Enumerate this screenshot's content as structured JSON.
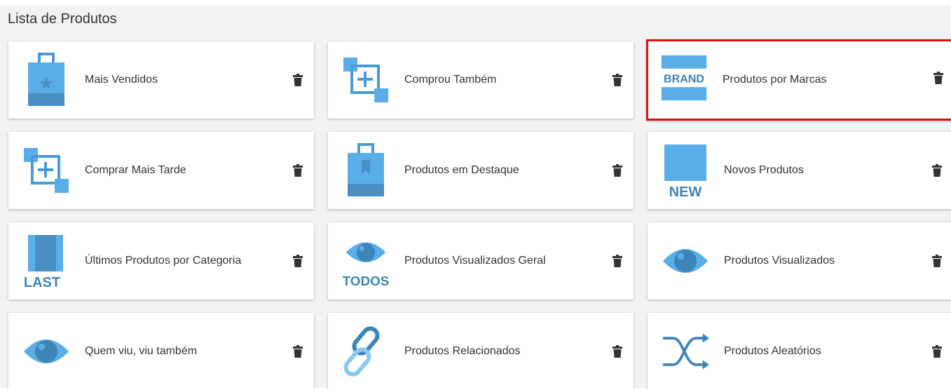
{
  "page": {
    "title": "Lista de Produtos"
  },
  "cards": [
    {
      "label": "Mais Vendidos",
      "icon": "shopping-bag-star-icon"
    },
    {
      "label": "Comprou Também",
      "icon": "add-squares-icon"
    },
    {
      "label": "Produtos por Marcas",
      "icon": "brand-icon",
      "icon_text": "BRAND",
      "highlighted": true
    },
    {
      "label": "Comprar Mais Tarde",
      "icon": "add-squares-icon"
    },
    {
      "label": "Produtos em Destaque",
      "icon": "shopping-bag-bookmark-icon"
    },
    {
      "label": "Novos Produtos",
      "icon": "new-icon",
      "icon_text": "NEW"
    },
    {
      "label": "Últimos Produtos por Categoria",
      "icon": "last-icon",
      "icon_text": "LAST"
    },
    {
      "label": "Produtos Visualizados Geral",
      "icon": "eye-todos-icon",
      "icon_text": "TODOS"
    },
    {
      "label": "Produtos Visualizados",
      "icon": "eye-icon"
    },
    {
      "label": "Quem viu, viu também",
      "icon": "eye-icon"
    },
    {
      "label": "Produtos Relacionados",
      "icon": "chain-link-icon"
    },
    {
      "label": "Produtos Aleatórios",
      "icon": "shuffle-icon"
    }
  ],
  "colors": {
    "icon_light": "#5aaee8",
    "icon_dark": "#3d85b8",
    "icon_mid": "#4a9bd4",
    "highlight_border": "#e01010",
    "trash": "#333333"
  }
}
